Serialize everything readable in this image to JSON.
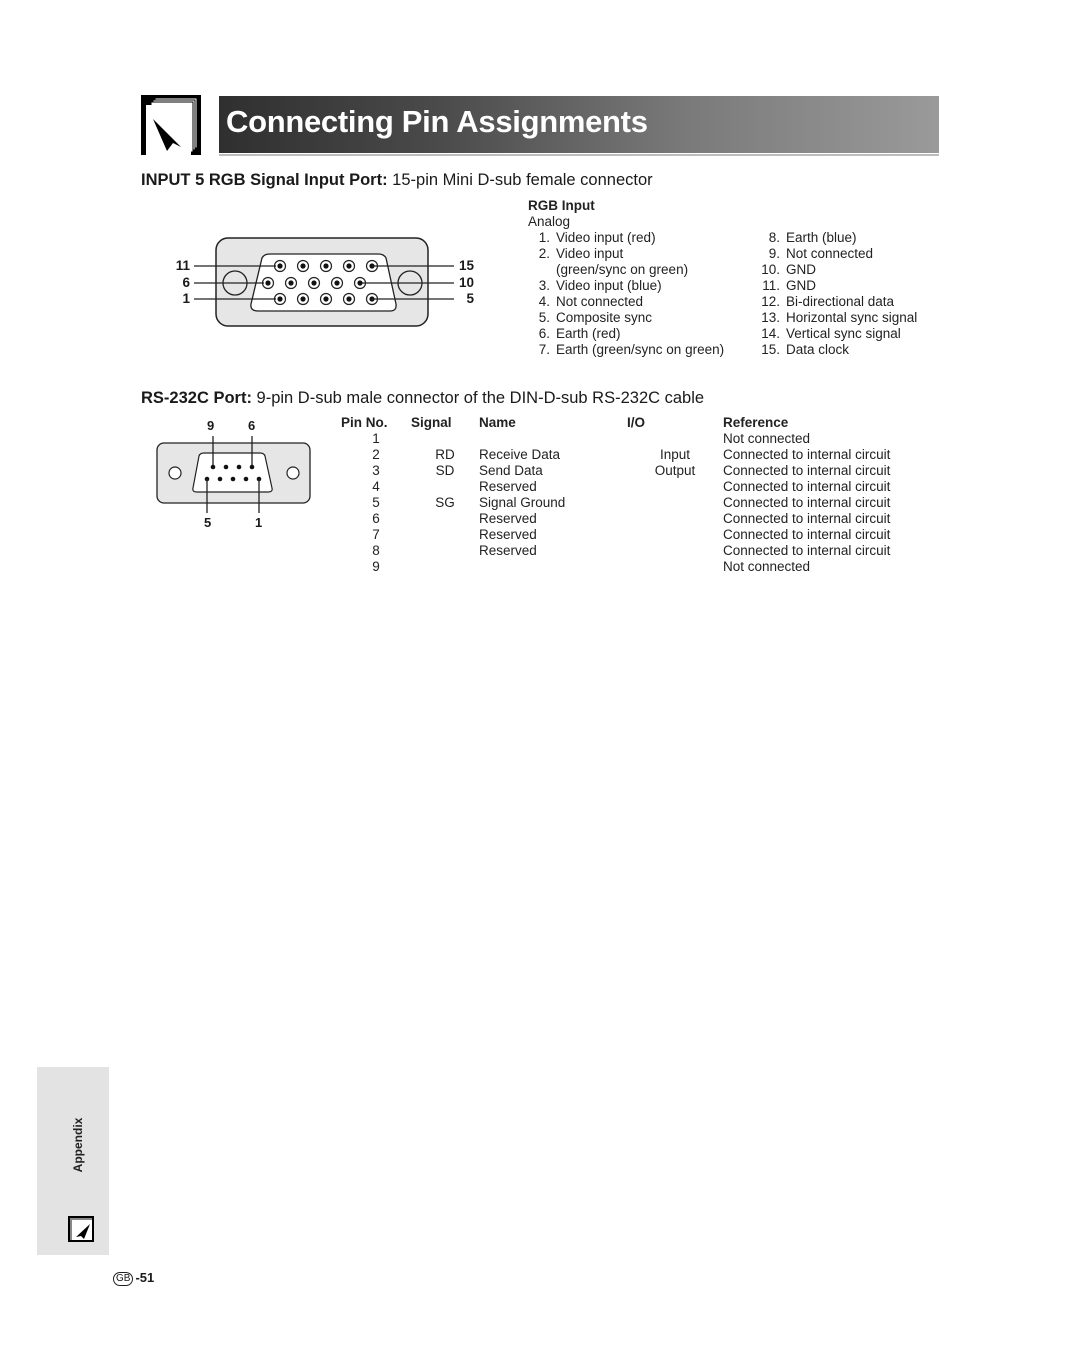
{
  "header": {
    "title": "Connecting Pin Assignments",
    "icon": "cursor-page-icon"
  },
  "rgb_section": {
    "heading_bold": "INPUT 5 RGB Signal Input Port:",
    "heading_rest": " 15-pin Mini D-sub female connector",
    "diagram_labels": {
      "left": [
        "11",
        "6",
        "1"
      ],
      "right": [
        "15",
        "10",
        "5"
      ]
    },
    "list_title": "RGB Input",
    "list_subtitle": "Analog",
    "pins_left": [
      {
        "num": "1.",
        "text": "Video input (red)"
      },
      {
        "num": "2.",
        "text": "Video input"
      },
      {
        "num": "",
        "text": "(green/sync on green)"
      },
      {
        "num": "3.",
        "text": "Video input (blue)"
      },
      {
        "num": "4.",
        "text": "Not connected"
      },
      {
        "num": "5.",
        "text": "Composite sync"
      },
      {
        "num": "6.",
        "text": "Earth (red)"
      },
      {
        "num": "7.",
        "text": "Earth (green/sync on green)"
      }
    ],
    "pins_right": [
      {
        "num": "8.",
        "text": "Earth (blue)"
      },
      {
        "num": "9.",
        "text": "Not connected"
      },
      {
        "num": "10.",
        "text": "GND"
      },
      {
        "num": "11.",
        "text": "GND"
      },
      {
        "num": "12.",
        "text": "Bi-directional data"
      },
      {
        "num": "13.",
        "text": "Horizontal sync signal"
      },
      {
        "num": "14.",
        "text": "Vertical sync signal"
      },
      {
        "num": "15.",
        "text": "Data clock"
      }
    ]
  },
  "rs232_section": {
    "heading_bold": "RS-232C Port:",
    "heading_rest": " 9-pin D-sub male connector of the DIN-D-sub RS-232C cable",
    "diagram_labels": {
      "top_left": "9",
      "top_right": "6",
      "bottom_left": "5",
      "bottom_right": "1"
    },
    "columns": [
      "Pin No.",
      "Signal",
      "Name",
      "I/O",
      "Reference"
    ],
    "rows": [
      {
        "pin": "1",
        "signal": "",
        "name": "",
        "io": "",
        "reference": "Not connected"
      },
      {
        "pin": "2",
        "signal": "RD",
        "name": "Receive Data",
        "io": "Input",
        "reference": "Connected to internal circuit"
      },
      {
        "pin": "3",
        "signal": "SD",
        "name": "Send Data",
        "io": "Output",
        "reference": "Connected to internal circuit"
      },
      {
        "pin": "4",
        "signal": "",
        "name": "Reserved",
        "io": "",
        "reference": "Connected to internal circuit"
      },
      {
        "pin": "5",
        "signal": "SG",
        "name": "Signal Ground",
        "io": "",
        "reference": "Connected to internal circuit"
      },
      {
        "pin": "6",
        "signal": "",
        "name": "Reserved",
        "io": "",
        "reference": "Connected to internal circuit"
      },
      {
        "pin": "7",
        "signal": "",
        "name": "Reserved",
        "io": "",
        "reference": "Connected to internal circuit"
      },
      {
        "pin": "8",
        "signal": "",
        "name": "Reserved",
        "io": "",
        "reference": "Connected to internal circuit"
      },
      {
        "pin": "9",
        "signal": "",
        "name": "",
        "io": "",
        "reference": "Not connected"
      }
    ]
  },
  "sidebar": {
    "tab_label": "Appendix",
    "icon": "cursor-page-icon"
  },
  "footer": {
    "region_badge": "GB",
    "page_number": "-51"
  }
}
